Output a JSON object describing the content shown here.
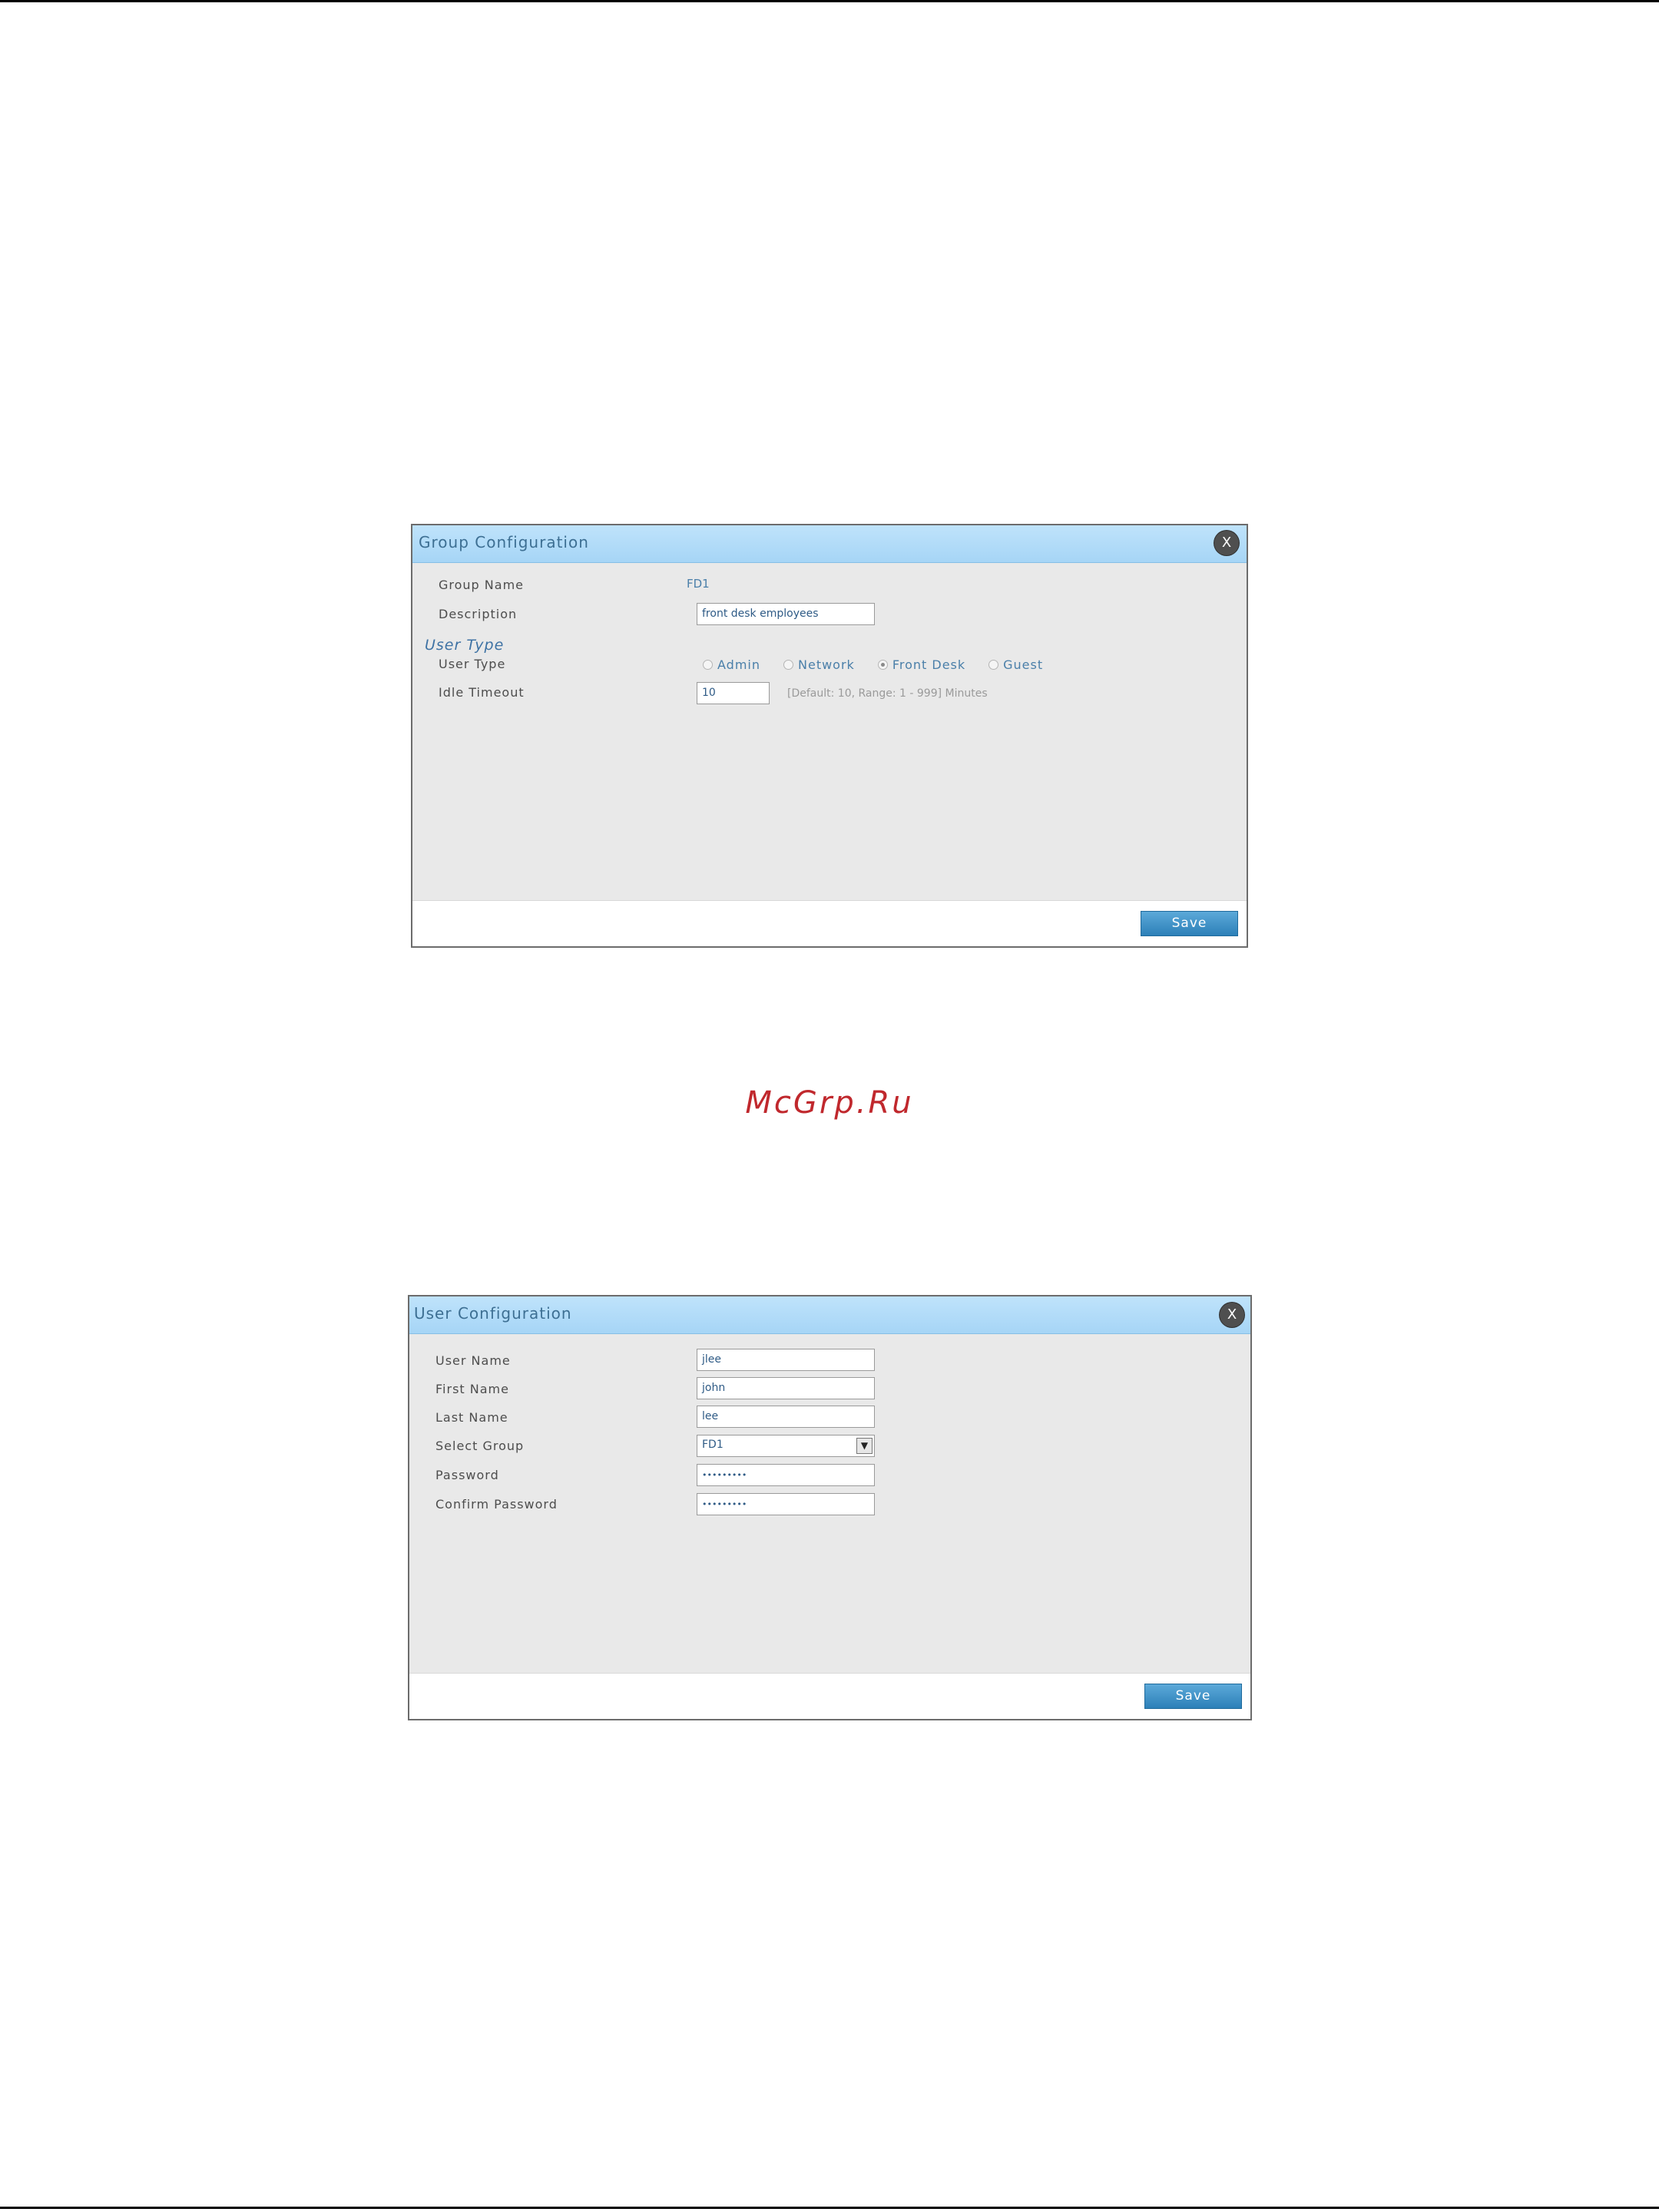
{
  "watermark": "McGrp.Ru",
  "group_dialog": {
    "title": "Group Configuration",
    "close_label": "X",
    "fields": {
      "group_name_label": "Group Name",
      "group_name_value": "FD1",
      "description_label": "Description",
      "description_value": "front desk employees",
      "section_title": "User Type",
      "user_type_label": "User Type",
      "user_type_options": [
        "Admin",
        "Network",
        "Front Desk",
        "Guest"
      ],
      "user_type_selected": "Front Desk",
      "idle_timeout_label": "Idle Timeout",
      "idle_timeout_value": "10",
      "idle_timeout_hint": "[Default: 10, Range: 1 - 999] Minutes"
    },
    "save_label": "Save"
  },
  "user_dialog": {
    "title": "User Configuration",
    "close_label": "X",
    "fields": {
      "user_name_label": "User Name",
      "user_name_value": "jlee",
      "first_name_label": "First Name",
      "first_name_value": "john",
      "last_name_label": "Last Name",
      "last_name_value": "lee",
      "select_group_label": "Select Group",
      "select_group_value": "FD1",
      "password_label": "Password",
      "password_value": "•••••••••",
      "confirm_password_label": "Confirm Password",
      "confirm_password_value": "•••••••••"
    },
    "save_label": "Save"
  }
}
